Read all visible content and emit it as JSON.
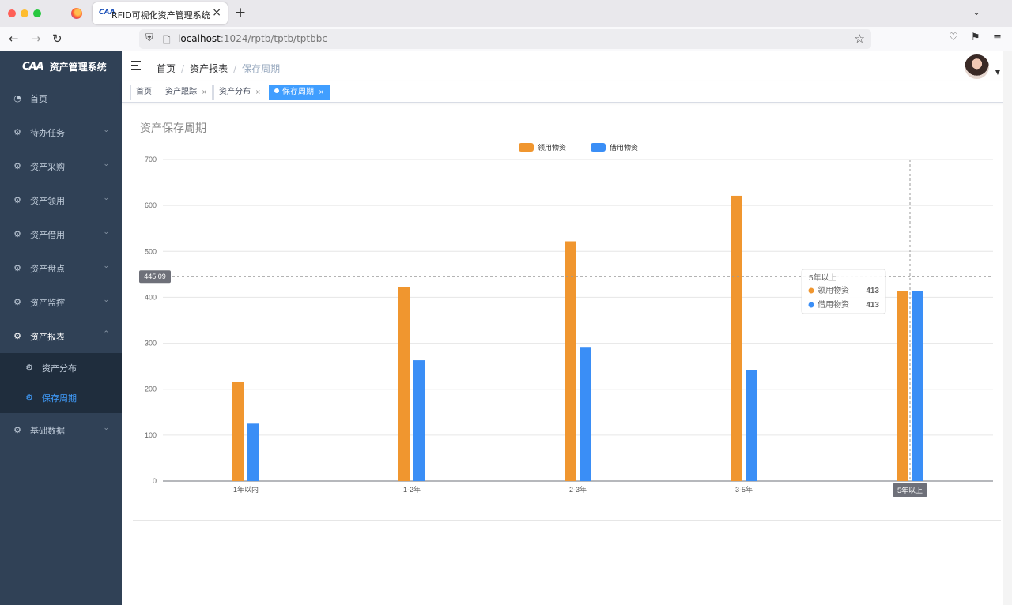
{
  "browser": {
    "tab_title": "RFID可视化资产管理系统",
    "tab_favicon_text": "CAA",
    "url_host": "localhost",
    "url_path": ":1024/rptb/tptb/tptbbc",
    "icons": [
      "back-icon",
      "forward-icon",
      "reload-icon",
      "shield-icon",
      "page-icon",
      "bookmark-star-icon",
      "pocket-icon",
      "extensions-icon",
      "menu-icon",
      "new-tab-icon",
      "tab-list-icon",
      "tab-close-icon"
    ]
  },
  "sidebar": {
    "logo_mark": "CAA",
    "logo_text": "资产管理系统",
    "items": [
      {
        "label": "首页",
        "icon": "dashboard-icon",
        "expandable": false
      },
      {
        "label": "待办任务",
        "icon": "gear-icon",
        "expandable": true
      },
      {
        "label": "资产采购",
        "icon": "gear-icon",
        "expandable": true
      },
      {
        "label": "资产领用",
        "icon": "gear-icon",
        "expandable": true
      },
      {
        "label": "资产借用",
        "icon": "gear-icon",
        "expandable": true
      },
      {
        "label": "资产盘点",
        "icon": "gear-icon",
        "expandable": true
      },
      {
        "label": "资产监控",
        "icon": "gear-icon",
        "expandable": true
      },
      {
        "label": "资产报表",
        "icon": "gear-icon",
        "expandable": true,
        "expanded": true
      },
      {
        "label": "基础数据",
        "icon": "gear-icon",
        "expandable": true
      }
    ],
    "submenu": [
      {
        "label": "资产分布",
        "active": false
      },
      {
        "label": "保存周期",
        "active": true
      }
    ],
    "colors": {
      "bg": "#304156",
      "submenu_bg": "#1f2d3d",
      "text": "#bfcbd9",
      "active": "#409eff"
    }
  },
  "header": {
    "breadcrumb": [
      "首页",
      "资产报表",
      "保存周期"
    ]
  },
  "tags": [
    {
      "label": "首页",
      "closable": false,
      "active": false
    },
    {
      "label": "资产跟踪",
      "closable": true,
      "active": false
    },
    {
      "label": "资产分布",
      "closable": true,
      "active": false
    },
    {
      "label": "保存周期",
      "closable": true,
      "active": true
    }
  ],
  "close_glyph": "×",
  "chart_data": {
    "type": "bar",
    "title": "资产保存周期",
    "categories": [
      "1年以内",
      "1-2年",
      "2-3年",
      "3-5年",
      "5年以上"
    ],
    "series": [
      {
        "name": "领用物资",
        "color": "#f0962f",
        "values": [
          215,
          423,
          522,
          621,
          413
        ]
      },
      {
        "name": "借用物资",
        "color": "#3a8ef6",
        "values": [
          125,
          263,
          292,
          241,
          413
        ]
      }
    ],
    "ylim": [
      0,
      700
    ],
    "yticks": [
      0,
      100,
      200,
      300,
      400,
      500,
      600,
      700
    ],
    "grid": true,
    "legend": "top-center",
    "crosshair": {
      "y_value": 445.09,
      "y_label": "445.09",
      "x_category": "5年以上"
    },
    "tooltip": {
      "title": "5年以上",
      "rows": [
        {
          "name": "领用物资",
          "value": "413"
        },
        {
          "name": "借用物资",
          "value": "413"
        }
      ]
    }
  }
}
